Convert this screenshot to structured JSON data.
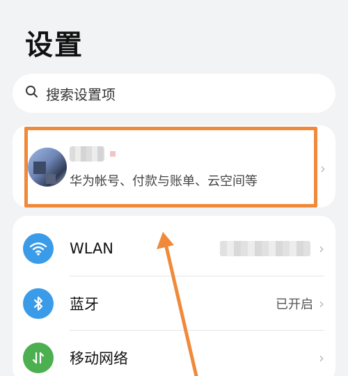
{
  "page": {
    "title": "设置"
  },
  "search": {
    "placeholder": "搜索设置项"
  },
  "account": {
    "subtitle": "华为帐号、付款与账单、云空间等",
    "chevron": "›"
  },
  "settings": [
    {
      "id": "wlan",
      "label": "WLAN",
      "value": "",
      "chevron": "›",
      "icon": "wifi-icon",
      "color": "#3a9be8"
    },
    {
      "id": "bluetooth",
      "label": "蓝牙",
      "value": "已开启",
      "chevron": "›",
      "icon": "bluetooth-icon",
      "color": "#3a9be8"
    },
    {
      "id": "mobile-network",
      "label": "移动网络",
      "value": "",
      "chevron": "›",
      "icon": "mobile-data-icon",
      "color": "#4caf50"
    }
  ],
  "annotation": {
    "color": "#f08a3a"
  }
}
